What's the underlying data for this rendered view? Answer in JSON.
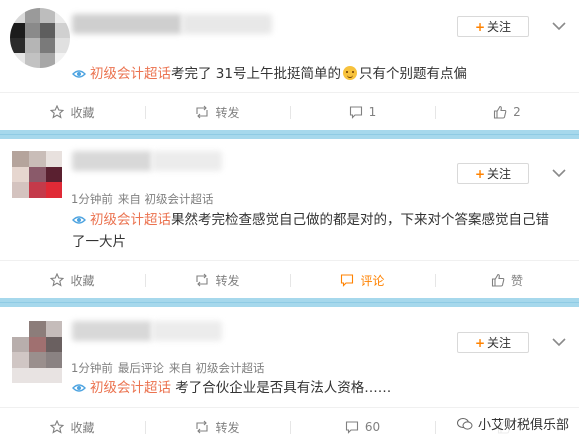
{
  "colors": {
    "topic": "#eb7350",
    "accent": "#ff8200",
    "separator": "#a6d8ec",
    "muted": "#808080"
  },
  "follow_label": "关注",
  "posts": [
    {
      "meta": null,
      "content": {
        "topic": "初级会计超话",
        "text_before_emoji": "考完了 31号上午批挺简单的",
        "text_after_emoji": "只有个别题有点偏"
      },
      "actions": {
        "favorite": "收藏",
        "repost": "转发",
        "comment": "1",
        "like": "2"
      }
    },
    {
      "meta": {
        "time": "1分钟前",
        "source": "来自 初级会计超话"
      },
      "content": {
        "topic": "初级会计超话",
        "text": "果然考完检查感觉自己做的都是对的，下来对个答案感觉自己错了一大片"
      },
      "actions": {
        "favorite": "收藏",
        "repost": "转发",
        "comment": "评论",
        "like": "赞"
      }
    },
    {
      "meta": {
        "time": "1分钟前",
        "last_comment": "最后评论",
        "source": "来自 初级会计超话"
      },
      "content": {
        "topic": "初级会计超话",
        "text": " 考了合伙企业是否具有法人资格……"
      },
      "actions": {
        "favorite": "收藏",
        "repost": "转发",
        "comment": "60",
        "like": ""
      }
    }
  ],
  "watermark": "小艾财税俱乐部"
}
